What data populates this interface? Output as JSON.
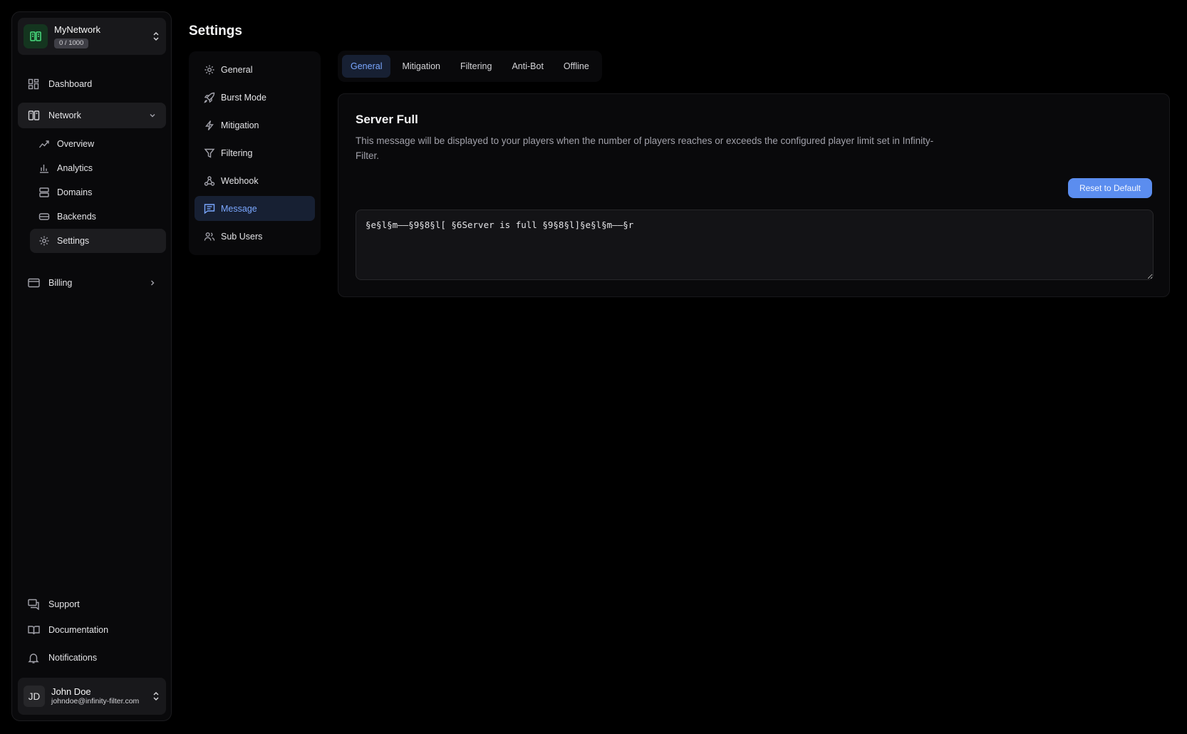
{
  "sidebar": {
    "network": {
      "name": "MyNetwork",
      "usage": "0 / 1000"
    },
    "dashboard": "Dashboard",
    "network_label": "Network",
    "network_items": [
      {
        "label": "Overview"
      },
      {
        "label": "Analytics"
      },
      {
        "label": "Domains"
      },
      {
        "label": "Backends"
      },
      {
        "label": "Settings"
      }
    ],
    "billing": "Billing",
    "support": "Support",
    "documentation": "Documentation",
    "notifications": "Notifications",
    "user": {
      "initials": "JD",
      "name": "John Doe",
      "email": "johndoe@infinity-filter.com"
    }
  },
  "page": {
    "title": "Settings",
    "settings_nav": [
      {
        "label": "General",
        "icon": "gear-icon"
      },
      {
        "label": "Burst Mode",
        "icon": "rocket-icon"
      },
      {
        "label": "Mitigation",
        "icon": "lightning-icon"
      },
      {
        "label": "Filtering",
        "icon": "funnel-icon"
      },
      {
        "label": "Webhook",
        "icon": "webhook-icon"
      },
      {
        "label": "Message",
        "icon": "message-icon",
        "active": true
      },
      {
        "label": "Sub Users",
        "icon": "users-icon"
      }
    ],
    "tabs": [
      {
        "label": "General",
        "active": true
      },
      {
        "label": "Mitigation"
      },
      {
        "label": "Filtering"
      },
      {
        "label": "Anti-Bot"
      },
      {
        "label": "Offline"
      }
    ],
    "card": {
      "title": "Server Full",
      "description": "This message will be displayed to your players when the number of players reaches or exceeds the configured player limit set in Infinity-Filter.",
      "reset_label": "Reset to Default",
      "message_value": "§e§l§m——§9§8§l[ §6Server is full §9§8§l]§e§l§m——§r"
    }
  },
  "colors": {
    "accent": "#5b8def",
    "active_text": "#7aa7ff",
    "active_bg": "#172033",
    "logo_green": "#4ade80"
  }
}
